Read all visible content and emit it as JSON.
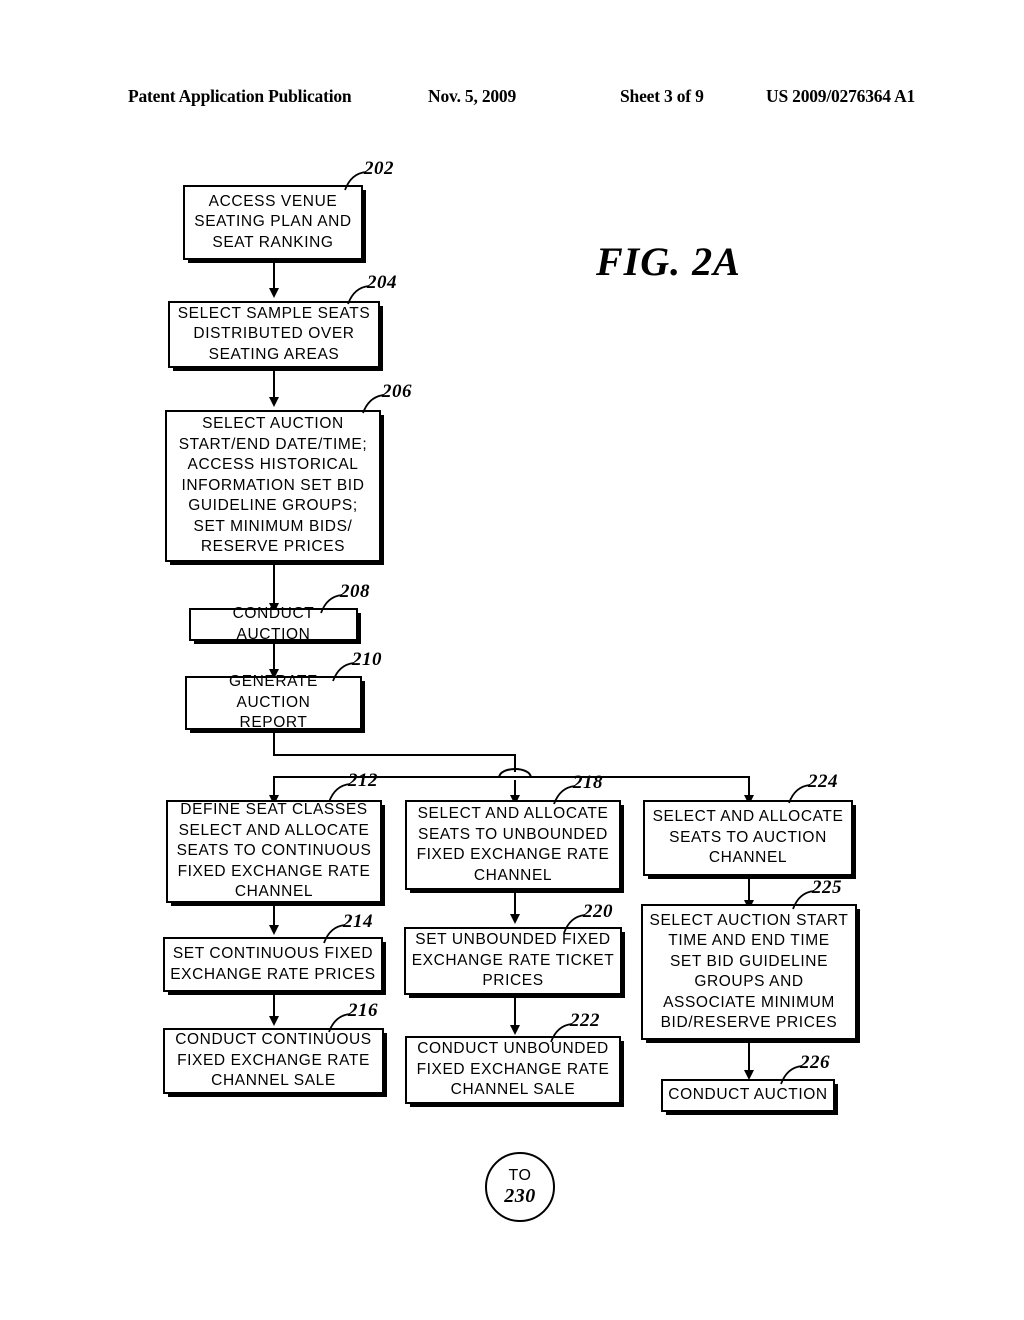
{
  "header": {
    "publication": "Patent Application Publication",
    "date": "Nov. 5, 2009",
    "sheet": "Sheet 3 of 9",
    "patent_number": "US 2009/0276364 A1"
  },
  "figure": {
    "title": "FIG.  2A"
  },
  "nodes": {
    "n202": {
      "ref": "202",
      "text": "ACCESS  VENUE\nSEATING  PLAN  AND\nSEAT  RANKING"
    },
    "n204": {
      "ref": "204",
      "text": "SELECT SAMPLE SEATS\nDISTRIBUTED  OVER\nSEATING  AREAS"
    },
    "n206": {
      "ref": "206",
      "text": "SELECT AUCTION\nSTART/END  DATE/TIME;\nACCESS  HISTORICAL\nINFORMATION SET BID\nGUIDELINE  GROUPS;\nSET  MINIMUM  BIDS/\nRESERVE  PRICES"
    },
    "n208": {
      "ref": "208",
      "text": "CONDUCT  AUCTION"
    },
    "n210": {
      "ref": "210",
      "text": "GENERATE  AUCTION\nREPORT"
    },
    "n212": {
      "ref": "212",
      "text": "DEFINE SEAT CLASSES\nSELECT AND ALLOCATE\nSEATS TO CONTINUOUS\nFIXED EXCHANGE RATE\nCHANNEL"
    },
    "n214": {
      "ref": "214",
      "text": "SET CONTINUOUS FIXED\nEXCHANGE  RATE  PRICES"
    },
    "n216": {
      "ref": "216",
      "text": "CONDUCT  CONTINUOUS\nFIXED  EXCHANGE  RATE\nCHANNEL  SALE"
    },
    "n218": {
      "ref": "218",
      "text": "SELECT AND ALLOCATE\nSEATS TO UNBOUNDED\nFIXED EXCHANGE RATE\nCHANNEL"
    },
    "n220": {
      "ref": "220",
      "text": "SET UNBOUNDED FIXED\nEXCHANGE RATE TICKET\nPRICES"
    },
    "n222": {
      "ref": "222",
      "text": "CONDUCT  UNBOUNDED\nFIXED  EXCHANGE  RATE\nCHANNEL  SALE"
    },
    "n224": {
      "ref": "224",
      "text": "SELECT AND ALLOCATE\nSEATS TO AUCTION\nCHANNEL"
    },
    "n225": {
      "ref": "225",
      "text": "SELECT AUCTION START\nTIME  AND  END  TIME\nSET  BID  GUIDELINE\nGROUPS  AND\nASSOCIATE  MINIMUM\nBID/RESERVE  PRICES"
    },
    "n226": {
      "ref": "226",
      "text": "CONDUCT  AUCTION"
    }
  },
  "connector": {
    "label_top": "TO",
    "label_number": "230"
  }
}
